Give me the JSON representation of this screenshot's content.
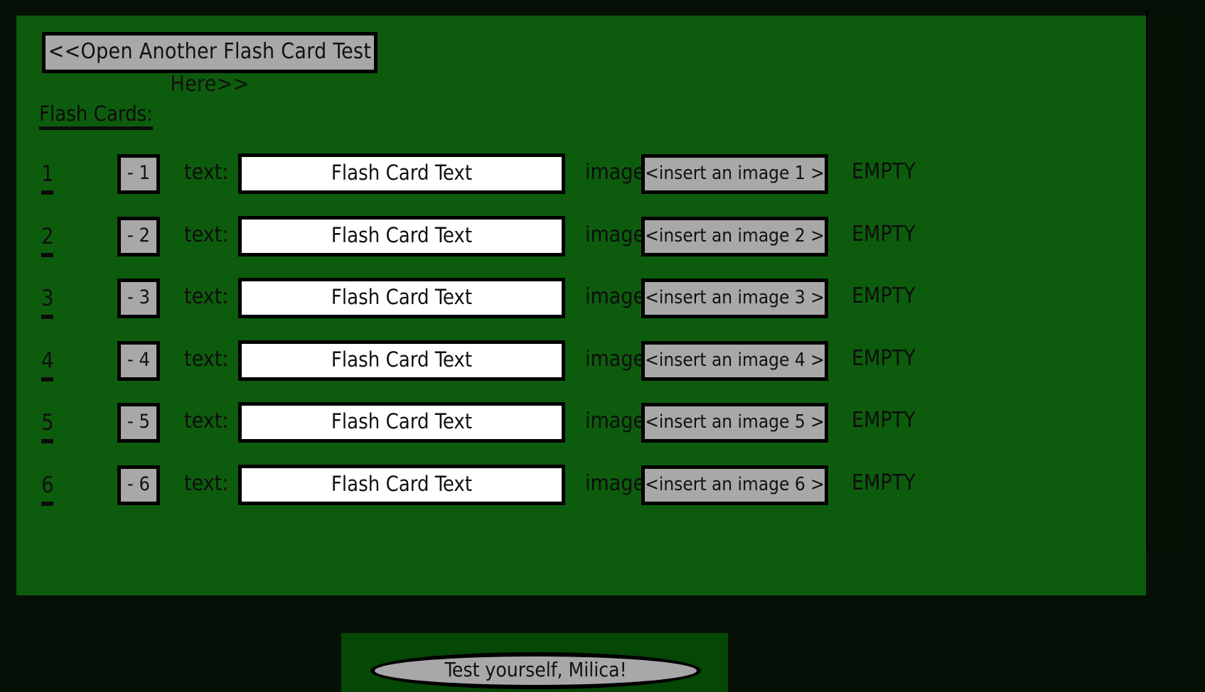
{
  "app": {
    "background_color": "#061006",
    "panel_color": "#0d5c0d",
    "bottom_panel_color": "#054705",
    "button_color": "#a8a8a8",
    "scroll_thumb_color": "#00cc00"
  },
  "header": {
    "open_another_test_label": "<<Open Another Flash Card Test Here>>",
    "section_heading": "Flash Cards:"
  },
  "labels": {
    "text_label": "text:",
    "image_label": "image:"
  },
  "rows": [
    {
      "index": "1",
      "minus_label": "- 1",
      "text_value": "Flash Card Text",
      "image_button_label": "<insert an image 1 >",
      "image_status": "EMPTY"
    },
    {
      "index": "2",
      "minus_label": "- 2",
      "text_value": "Flash Card Text",
      "image_button_label": "<insert an image 2 >",
      "image_status": "EMPTY"
    },
    {
      "index": "3",
      "minus_label": "- 3",
      "text_value": "Flash Card Text",
      "image_button_label": "<insert an image 3 >",
      "image_status": "EMPTY"
    },
    {
      "index": "4",
      "minus_label": "- 4",
      "text_value": "Flash Card Text",
      "image_button_label": "<insert an image 4 >",
      "image_status": "EMPTY"
    },
    {
      "index": "5",
      "minus_label": "- 5",
      "text_value": "Flash Card Text",
      "image_button_label": "<insert an image 5 >",
      "image_status": "EMPTY"
    },
    {
      "index": "6",
      "minus_label": "- 6",
      "text_value": "Flash Card Text",
      "image_button_label": "<insert an image 6 >",
      "image_status": "EMPTY"
    }
  ],
  "footer": {
    "test_button_label": "Test yourself, Milica!"
  }
}
